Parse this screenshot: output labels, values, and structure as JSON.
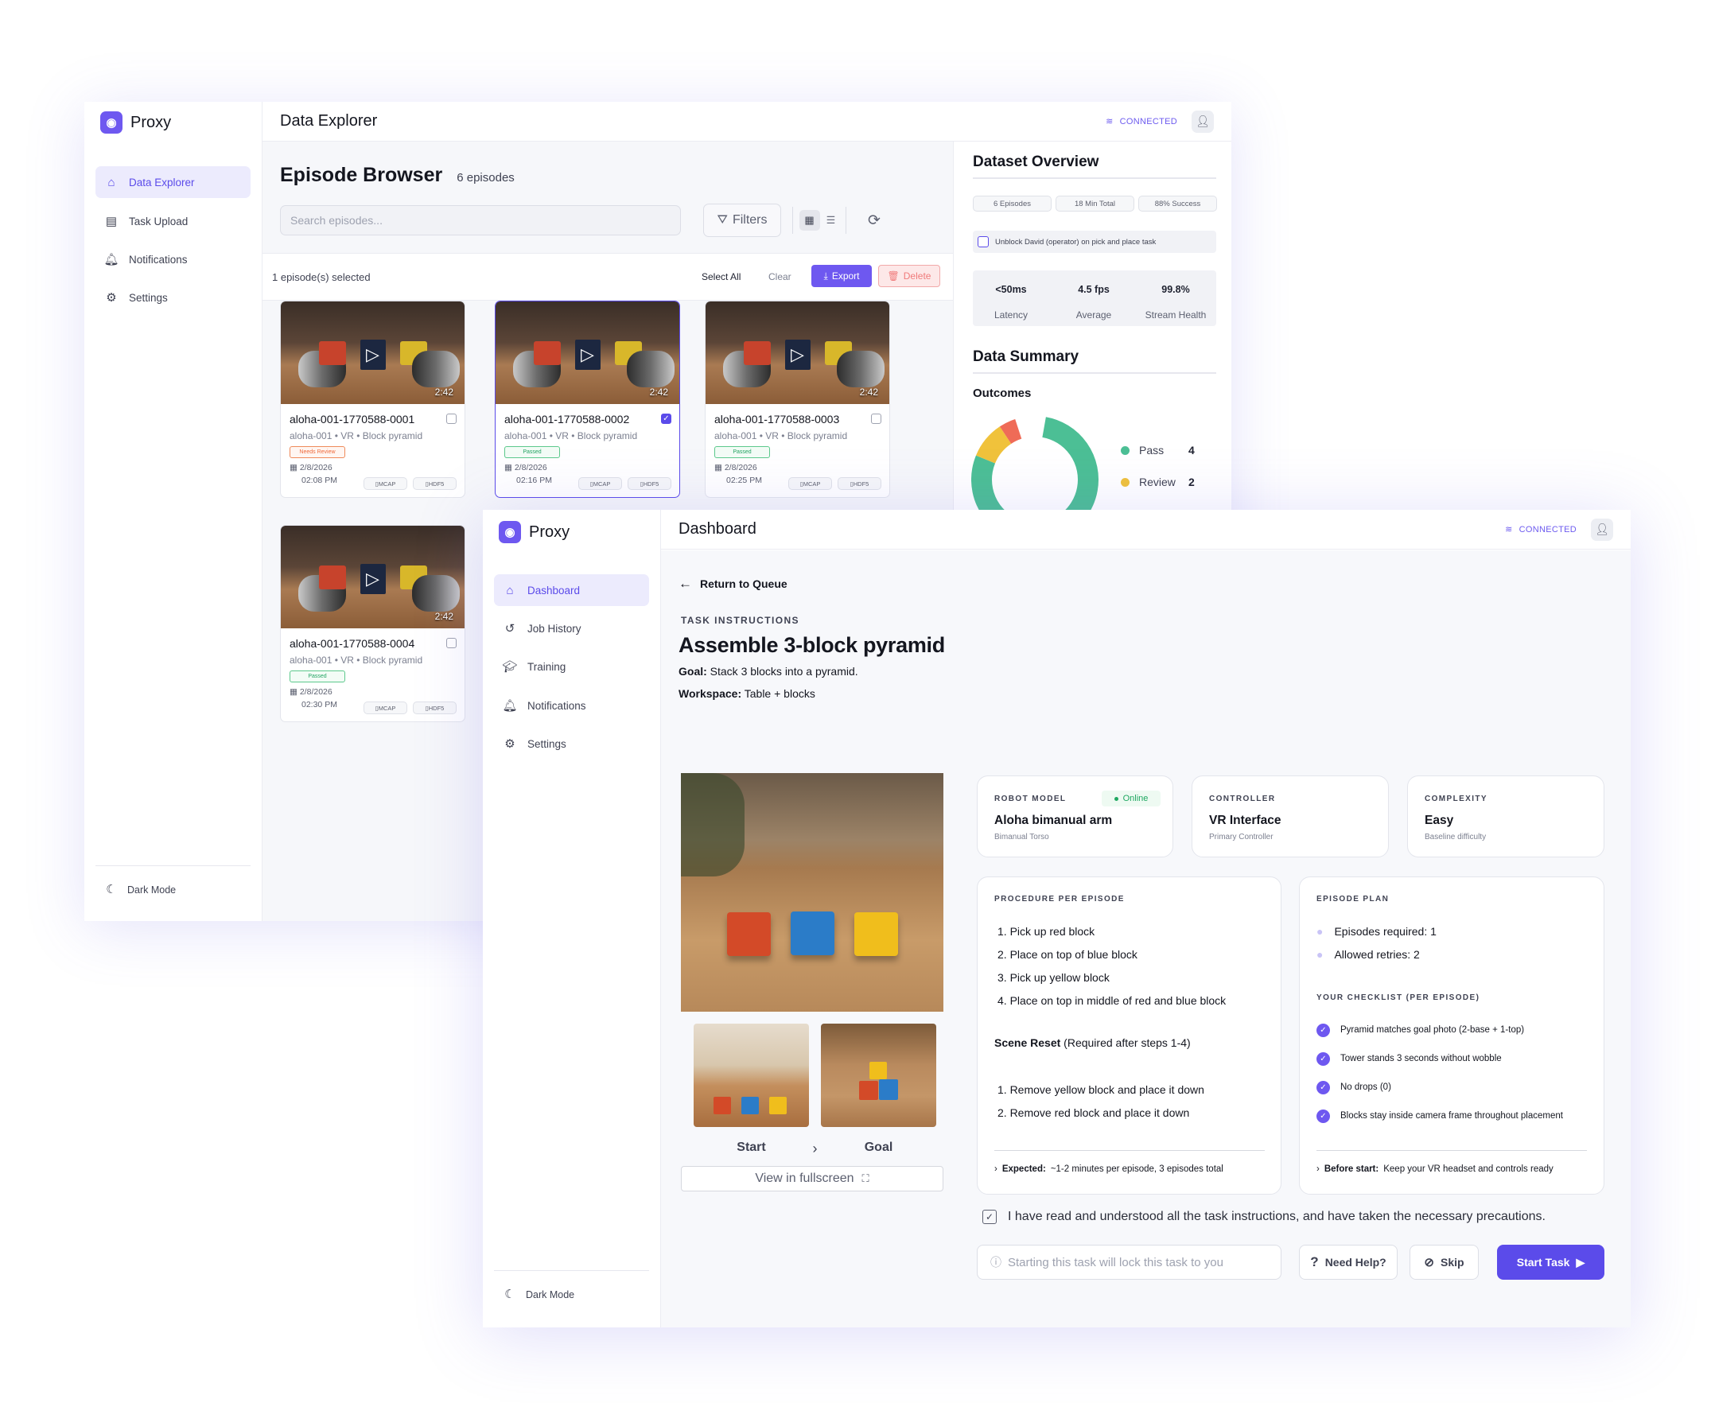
{
  "brand": {
    "name": "Proxy"
  },
  "explorer": {
    "title": "Data Explorer",
    "connection": "CONNECTED",
    "nav": [
      {
        "label": "Data Explorer"
      },
      {
        "label": "Task Upload"
      },
      {
        "label": "Notifications"
      },
      {
        "label": "Settings"
      }
    ],
    "dark_mode": "Dark Mode",
    "browser": {
      "heading": "Episode Browser",
      "count": "6 episodes",
      "search_placeholder": "Search episodes...",
      "filters": "Filters",
      "selected_text": "1 episode(s) selected",
      "select_all": "Select All",
      "clear": "Clear",
      "export": "Export",
      "delete": "Delete"
    },
    "episodes": [
      {
        "name": "aloha-001-1770588-0001",
        "meta": "aloha-001 • VR • Block pyramid",
        "status": "Needs Review",
        "date": "2/8/2026",
        "time": "02:08 PM",
        "duration": "2:42",
        "tag1": "MCAP",
        "tag2": "HDF5",
        "selected": false
      },
      {
        "name": "aloha-001-1770588-0002",
        "meta": "aloha-001 • VR • Block pyramid",
        "status": "Passed",
        "date": "2/8/2026",
        "time": "02:16 PM",
        "duration": "2:42",
        "tag1": "MCAP",
        "tag2": "HDF5",
        "selected": true
      },
      {
        "name": "aloha-001-1770588-0003",
        "meta": "aloha-001 • VR • Block pyramid",
        "status": "Passed",
        "date": "2/8/2026",
        "time": "02:25 PM",
        "duration": "2:42",
        "tag1": "MCAP",
        "tag2": "HDF5",
        "selected": false
      },
      {
        "name": "aloha-001-1770588-0004",
        "meta": "aloha-001 • VR • Block pyramid",
        "status": "Passed",
        "date": "2/8/2026",
        "time": "02:30 PM",
        "duration": "2:42",
        "tag1": "MCAP",
        "tag2": "HDF5",
        "selected": false
      }
    ],
    "overview": {
      "title": "Dataset Overview",
      "stats": [
        "6 Episodes",
        "18 Min Total",
        "88% Success"
      ],
      "unblock": "Unblock David (operator) on pick and place task",
      "metrics": [
        {
          "value": "<50ms",
          "label": "Latency"
        },
        {
          "value": "4.5 fps",
          "label": "Average"
        },
        {
          "value": "99.8%",
          "label": "Stream Health"
        }
      ],
      "summary_title": "Data Summary",
      "outcomes_title": "Outcomes",
      "legend": [
        {
          "label": "Pass",
          "value": "4",
          "color": "#4cbf95"
        },
        {
          "label": "Review",
          "value": "2",
          "color": "#f0c23b"
        }
      ]
    }
  },
  "dashboard": {
    "title": "Dashboard",
    "connection": "CONNECTED",
    "nav": [
      {
        "label": "Dashboard"
      },
      {
        "label": "Job History"
      },
      {
        "label": "Training"
      },
      {
        "label": "Notifications"
      },
      {
        "label": "Settings"
      }
    ],
    "dark_mode": "Dark Mode",
    "return": "Return to Queue",
    "task_label": "TASK INSTRUCTIONS",
    "task_title": "Assemble 3-block pyramid",
    "goal_label": "Goal:",
    "goal_text": "Stack 3 blocks into a pyramid.",
    "workspace_label": "Workspace:",
    "workspace_text": "Table + blocks",
    "start_label": "Start",
    "goal_img_label": "Goal",
    "fullscreen": "View in fullscreen",
    "robot": {
      "label": "ROBOT MODEL",
      "status": "Online",
      "value": "Aloha bimanual arm",
      "sub": "Bimanual Torso"
    },
    "controller": {
      "label": "CONTROLLER",
      "value": "VR Interface",
      "sub": "Primary Controller"
    },
    "complexity": {
      "label": "COMPLEXITY",
      "value": "Easy",
      "sub": "Baseline difficulty"
    },
    "procedure": {
      "label": "PROCEDURE PER EPISODE",
      "steps": [
        "1. Pick up red block",
        "2. Place on top of blue block",
        "3. Pick up yellow block",
        "4. Place on top in middle of red and blue block"
      ],
      "reset_title": "Scene Reset",
      "reset_note": "(Required after steps 1-4)",
      "reset_steps": [
        "1. Remove yellow block and place it down",
        "2. Remove red block and place it down"
      ],
      "expected_label": "Expected:",
      "expected_text": "~1-2 minutes per episode, 3 episodes total"
    },
    "plan": {
      "label": "EPISODE PLAN",
      "items": [
        "Episodes required: 1",
        "Allowed retries: 2"
      ],
      "checklist_label": "YOUR CHECKLIST (PER EPISODE)",
      "checklist": [
        "Pyramid matches goal photo (2-base + 1-top)",
        "Tower stands 3 seconds without wobble",
        "No drops (0)",
        "Blocks stay inside camera frame throughout placement"
      ],
      "before_label": "Before start:",
      "before_text": "Keep your VR headset and controls ready"
    },
    "ack": "I have read and understood all the task instructions, and have taken the necessary precautions.",
    "lock_note": "Starting this task will lock this task to you",
    "help": "Need Help?",
    "skip": "Skip",
    "start": "Start Task",
    "accent": "#5b4bea"
  }
}
